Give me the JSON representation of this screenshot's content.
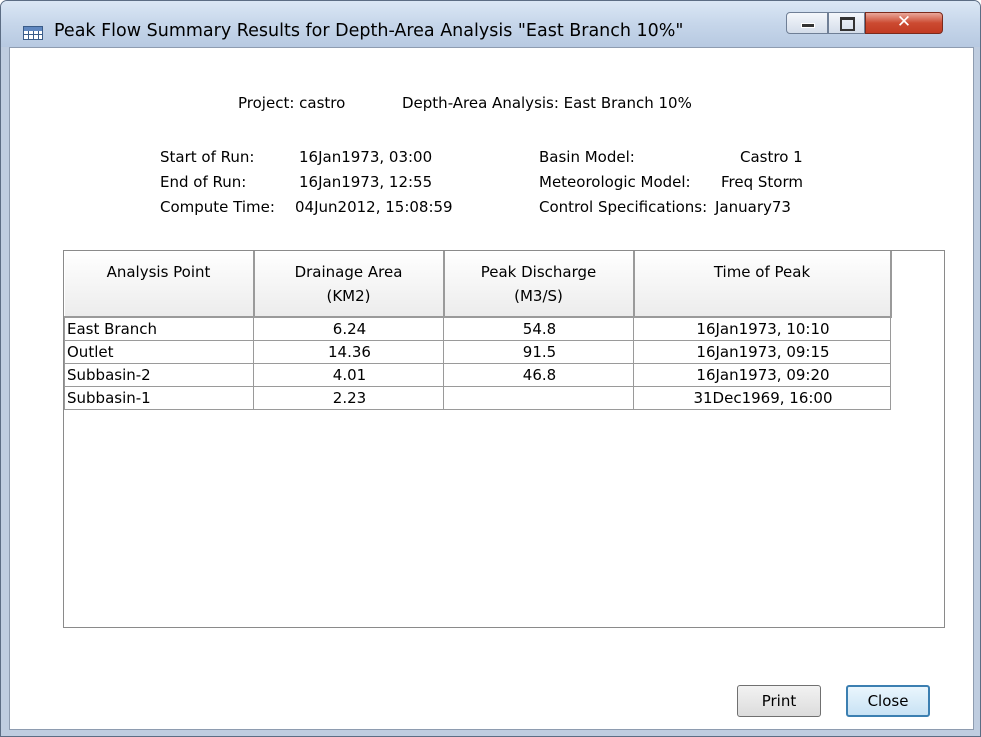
{
  "window": {
    "title": "Peak Flow Summary Results for Depth-Area Analysis \"East Branch 10%\""
  },
  "summary": {
    "project": "Project: castro",
    "analysis": "Depth-Area Analysis: East Branch 10%",
    "start_label": "Start of Run:",
    "start_value": "16Jan1973, 03:00",
    "end_label": "End of Run:",
    "end_value": "16Jan1973, 12:55",
    "compute_label": "Compute Time:",
    "compute_value": "04Jun2012, 15:08:59",
    "basin_label": "Basin Model:",
    "basin_value": "Castro 1",
    "met_label": "Meteorologic Model:",
    "met_value": "Freq Storm",
    "control_label": "Control Specifications:",
    "control_value": "January73"
  },
  "table": {
    "headers": [
      {
        "line1": "Analysis Point",
        "line2": ""
      },
      {
        "line1": "Drainage Area",
        "line2": "(KM2)"
      },
      {
        "line1": "Peak Discharge",
        "line2": "(M3/S)"
      },
      {
        "line1": "Time of Peak",
        "line2": ""
      }
    ],
    "rows": [
      {
        "point": "East Branch",
        "area": "6.24",
        "discharge": "54.8",
        "time": "16Jan1973, 10:10"
      },
      {
        "point": "Outlet",
        "area": "14.36",
        "discharge": "91.5",
        "time": "16Jan1973, 09:15"
      },
      {
        "point": "Subbasin-2",
        "area": "4.01",
        "discharge": "46.8",
        "time": "16Jan1973, 09:20"
      },
      {
        "point": "Subbasin-1",
        "area": "2.23",
        "discharge": "",
        "time": "31Dec1969, 16:00"
      }
    ]
  },
  "buttons": {
    "print": "Print",
    "close": "Close"
  }
}
